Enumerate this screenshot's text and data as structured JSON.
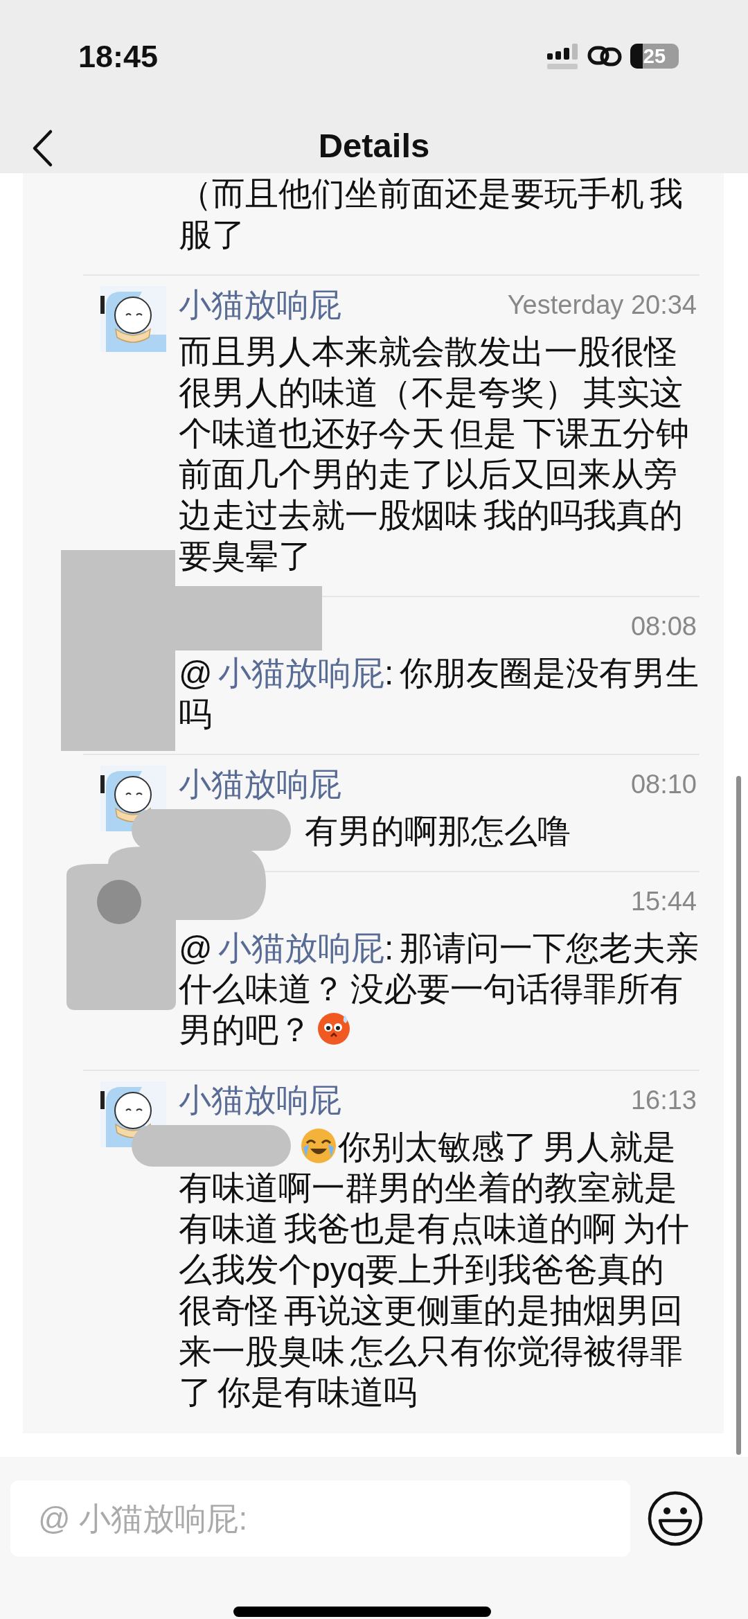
{
  "status_bar": {
    "time": "18:45",
    "battery": "25"
  },
  "nav": {
    "title": "Details"
  },
  "comments": [
    {
      "kind": "continued",
      "segments": [
        {
          "kind": "plain",
          "text": "（而且他们坐前面还是要玩手机 我服了"
        }
      ]
    },
    {
      "kind": "full",
      "avatar": true,
      "name": "小猫放响屁",
      "time": "Yesterday 20:34",
      "segments": [
        {
          "kind": "plain",
          "text": "而且男人本来就会散发出一股很怪很男人的味道（不是夸奖） 其实这个味道也还好今天 但是 下课五分钟前面几个男的走了以后又回来从旁边走过去就一股烟味 我的吗我真的要臭晕了"
        }
      ]
    },
    {
      "kind": "full",
      "avatar": false,
      "redaction": {
        "kind": "block"
      },
      "time": "08:08",
      "segments": [
        {
          "kind": "plain",
          "text": "@ "
        },
        {
          "kind": "mention",
          "text": "小猫放响屁"
        },
        {
          "kind": "plain",
          "text": ": 你朋友圈是没有男生吗"
        }
      ]
    },
    {
      "kind": "full",
      "avatar": true,
      "redaction": {
        "kind": "pill"
      },
      "name": "小猫放响屁",
      "time": "08:10",
      "segments": [
        {
          "kind": "plain",
          "text": "有男的啊那怎么噜"
        }
      ]
    },
    {
      "kind": "full",
      "avatar": false,
      "redaction": {
        "kind": "blob"
      },
      "time": "15:44",
      "emoji_after": {
        "kind": "sweat"
      },
      "segments": [
        {
          "kind": "plain",
          "text": "@ "
        },
        {
          "kind": "mention",
          "text": "小猫放响屁"
        },
        {
          "kind": "plain",
          "text": ": 那请问一下您老夫亲什么味道？ 没必要一句话得罪所有男的吧？"
        }
      ]
    },
    {
      "kind": "full",
      "avatar": true,
      "redaction": {
        "kind": "pill"
      },
      "name": "小猫放响屁",
      "time": "16:13",
      "emoji_before": {
        "kind": "tears"
      },
      "segments": [
        {
          "kind": "plain",
          "text": "你别太敏感了 男人就是有味道啊一群男的坐着的教室就是有味道 我爸也是有点味道的啊 为什么我发个pyq要上升到我爸爸真的很奇怪 再说这更侧重的是抽烟男回来一股臭味 怎么只有你觉得被得罪了 你是有味道吗"
        }
      ]
    }
  ],
  "input": {
    "placeholder": "@ 小猫放响屁:"
  }
}
